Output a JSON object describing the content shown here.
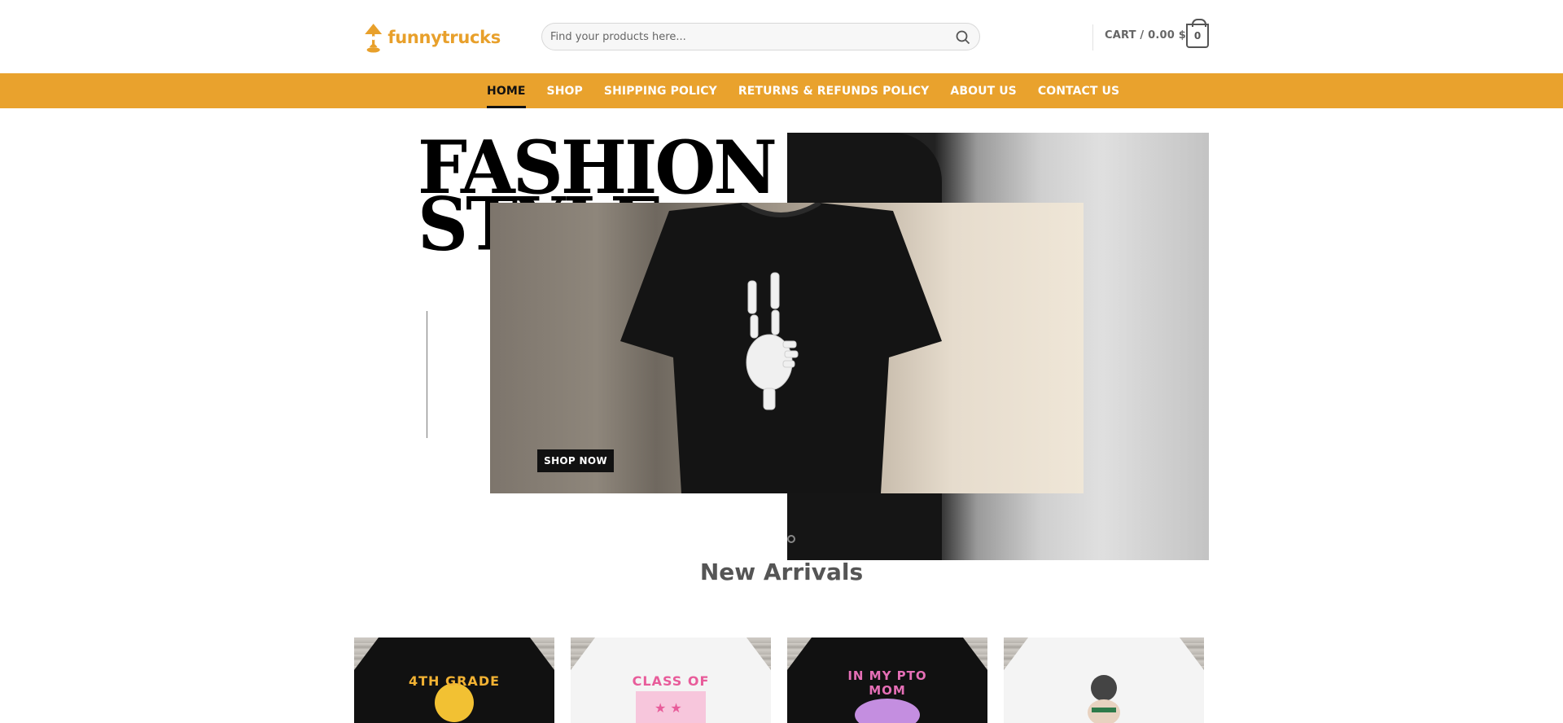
{
  "header": {
    "logo_text": "funnytrucks",
    "search_placeholder": "Find your products here...",
    "cart_label": "CART / 0.00 $",
    "cart_count": "0"
  },
  "nav": {
    "items": [
      {
        "label": "HOME",
        "active": true
      },
      {
        "label": "SHOP"
      },
      {
        "label": "SHIPPING POLICY"
      },
      {
        "label": "RETURNS & REFUNDS POLICY"
      },
      {
        "label": "ABOUT US"
      },
      {
        "label": "CONTACT US"
      }
    ]
  },
  "hero": {
    "title_line1": "FASHION",
    "title_line2": "STYLE",
    "cta_label": "SHOP NOW"
  },
  "new_arrivals": {
    "title": "New Arrivals",
    "products": [
      {
        "shirt_color": "#111111",
        "graphic_text": "4TH GRADE",
        "graphic_color": "#f2b233"
      },
      {
        "shirt_color": "#f4f4f4",
        "graphic_text": "CLASS OF",
        "graphic_color": "#e85c9a"
      },
      {
        "shirt_color": "#111111",
        "graphic_text": "IN MY PTO MOM",
        "graphic_color": "#e56fb6"
      },
      {
        "shirt_color": "#f4f4f4",
        "graphic_text": "",
        "graphic_color": "#444444"
      }
    ]
  },
  "colors": {
    "brand": "#e9a22d",
    "nav_text": "#ffffff",
    "nav_active": "#111111"
  }
}
